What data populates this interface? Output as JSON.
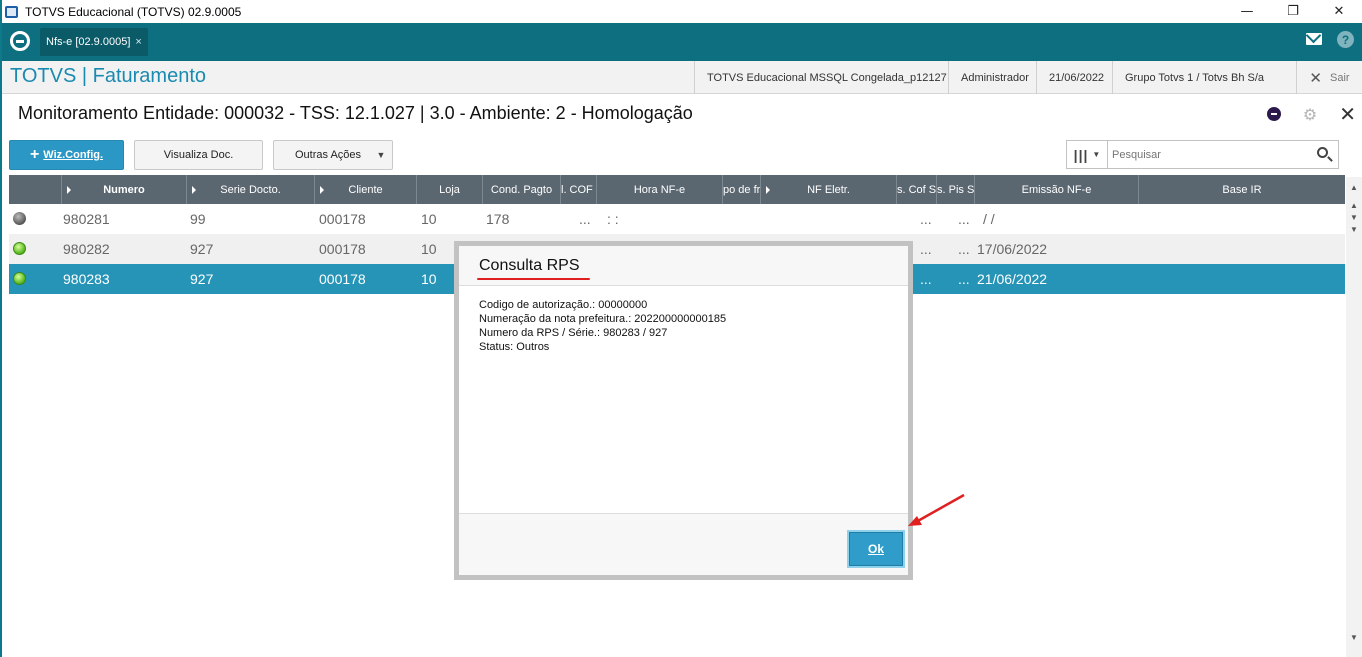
{
  "window": {
    "title": "TOTVS Educacional (TOTVS) 02.9.0005",
    "minimize": "—",
    "restore": "❐",
    "close": "✕"
  },
  "appbar": {
    "tab_label": "Nfs-e [02.9.0005]",
    "tab_close": "×",
    "help": "?"
  },
  "module": {
    "title": "TOTVS | Faturamento",
    "environment": "TOTVS Educacional MSSQL Congelada_p12127",
    "user": "Administrador",
    "date": "21/06/2022",
    "company": "Grupo Totvs 1 / Totvs  Bh S/a",
    "exit_label": "Sair"
  },
  "page": {
    "title": "Monitoramento Entidade: 000032 - TSS: 12.1.027 | 3.0 - Ambiente: 2 - Homologação"
  },
  "toolbar": {
    "wiz_label": "Wiz.Config.",
    "visualiza_label": "Visualiza Doc.",
    "outras_label": "Outras Ações",
    "search_placeholder": "Pesquisar"
  },
  "grid": {
    "columns": [
      "Numero",
      "Serie Docto.",
      "Cliente",
      "Loja",
      "Cond. Pagto",
      "l. COF S",
      "Hora NF-e",
      "po de fr",
      "NF Eletr.",
      "s. Cof S",
      "s. Pis S",
      "Emissão NF-e",
      "Base IR"
    ],
    "rows": [
      {
        "status": "gray",
        "numero": "980281",
        "serie": "99",
        "cliente": "000178",
        "loja": "10",
        "cond": "178",
        "cof": "...",
        "hora": ": :",
        "cofs": "...",
        "pis": "...",
        "emissao": " /  /"
      },
      {
        "status": "green",
        "numero": "980282",
        "serie": "927",
        "cliente": "000178",
        "loja": "10",
        "cond": "",
        "cof": "",
        "hora": "",
        "cofs": "...",
        "pis": "...",
        "emissao": "17/06/2022"
      },
      {
        "status": "green",
        "numero": "980283",
        "serie": "927",
        "cliente": "000178",
        "loja": "10",
        "cond": "",
        "cof": "",
        "hora": "",
        "cofs": "...",
        "pis": "...",
        "emissao": "21/06/2022",
        "selected": true
      }
    ]
  },
  "dialog": {
    "title": "Consulta RPS",
    "lines": [
      "Codigo de autorização.: 00000000",
      "Numeração da nota prefeitura.: 202200000000185",
      "Numero da RPS / Série.: 980283 / 927",
      "Status: Outros"
    ],
    "ok_label": "Ok"
  }
}
